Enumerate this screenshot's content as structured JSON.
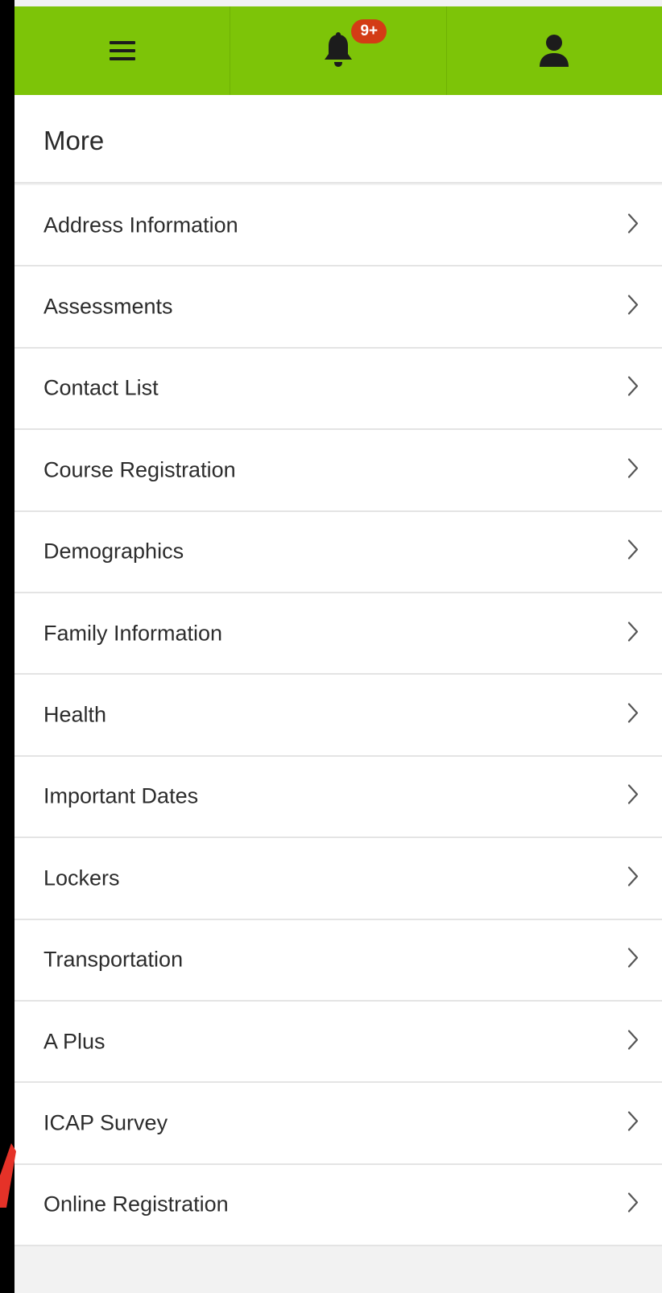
{
  "colors": {
    "topbar": "#7dc408",
    "badge": "#d33c15",
    "background": "#f2f2f2",
    "annotation": "#e53228"
  },
  "topbar": {
    "menu_icon": "hamburger-menu-icon",
    "notification_icon": "bell-icon",
    "notification_badge": "9+",
    "profile_icon": "user-icon"
  },
  "section": {
    "title": "More"
  },
  "menu": {
    "chevron_icon": "chevron-right-icon",
    "items": [
      {
        "label": "Address Information"
      },
      {
        "label": "Assessments"
      },
      {
        "label": "Contact List"
      },
      {
        "label": "Course Registration"
      },
      {
        "label": "Demographics"
      },
      {
        "label": "Family Information"
      },
      {
        "label": "Health"
      },
      {
        "label": "Important Dates"
      },
      {
        "label": "Lockers"
      },
      {
        "label": "Transportation"
      },
      {
        "label": "A Plus"
      },
      {
        "label": "ICAP Survey"
      },
      {
        "label": "Online Registration"
      }
    ]
  }
}
